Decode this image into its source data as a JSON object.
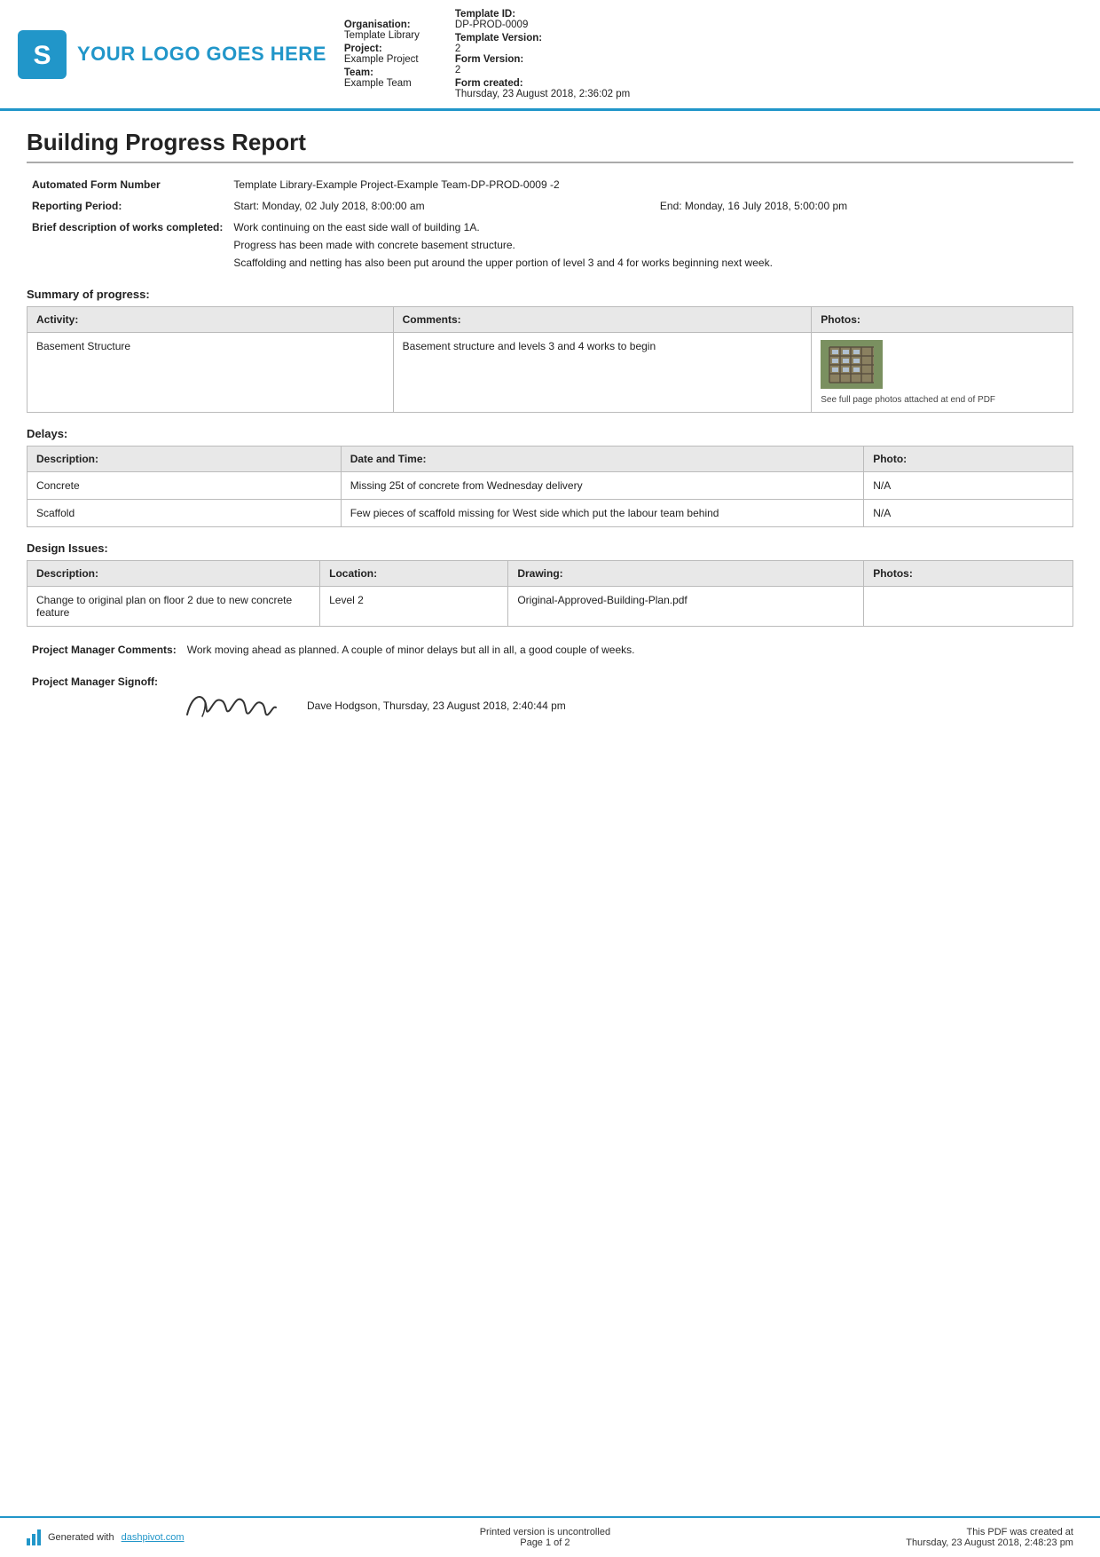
{
  "header": {
    "logo_text": "YOUR LOGO GOES HERE",
    "org_label": "Organisation:",
    "org_value": "Template Library",
    "project_label": "Project:",
    "project_value": "Example Project",
    "team_label": "Team:",
    "team_value": "Example Team",
    "template_id_label": "Template ID:",
    "template_id_value": "DP-PROD-0009",
    "template_version_label": "Template Version:",
    "template_version_value": "2",
    "form_version_label": "Form Version:",
    "form_version_value": "2",
    "form_created_label": "Form created:",
    "form_created_value": "Thursday, 23 August 2018, 2:36:02 pm"
  },
  "report": {
    "title": "Building Progress Report",
    "automated_form_number_label": "Automated Form Number",
    "automated_form_number_value": "Template Library-Example Project-Example Team-DP-PROD-0009   -2",
    "reporting_period_label": "Reporting Period:",
    "reporting_period_start": "Start: Monday, 02 July 2018, 8:00:00 am",
    "reporting_period_end": "End: Monday, 16 July 2018, 5:00:00 pm",
    "brief_description_label": "Brief description of works completed:",
    "brief_description_lines": [
      "Work continuing on the east side wall of building 1A.",
      "Progress has been made with concrete basement structure.",
      "Scaffolding and netting has also been put around the upper portion of level 3 and 4 for works beginning next week."
    ],
    "summary_header": "Summary of progress:",
    "summary_columns": [
      "Activity:",
      "Comments:",
      "Photos:"
    ],
    "summary_rows": [
      {
        "activity": "Basement Structure",
        "comments": "Basement structure and levels 3 and 4 works to begin",
        "has_photo": true,
        "photo_caption": "See full page photos attached at end of PDF"
      }
    ],
    "delays_header": "Delays:",
    "delays_columns": [
      "Description:",
      "Date and Time:",
      "Photo:"
    ],
    "delays_rows": [
      {
        "description": "Concrete",
        "date_time": "Missing 25t of concrete from Wednesday delivery",
        "photo": "N/A"
      },
      {
        "description": "Scaffold",
        "date_time": "Few pieces of scaffold missing for West side which put the labour team behind",
        "photo": "N/A"
      }
    ],
    "design_issues_header": "Design Issues:",
    "design_columns": [
      "Description:",
      "Location:",
      "Drawing:",
      "Photos:"
    ],
    "design_rows": [
      {
        "description": "Change to original plan on floor 2 due to new concrete feature",
        "location": "Level 2",
        "drawing": "Original-Approved-Building-Plan.pdf",
        "photo": ""
      }
    ],
    "pm_comments_label": "Project Manager Comments:",
    "pm_comments_value": "Work moving ahead as planned. A couple of minor delays but all in all, a good couple of weeks.",
    "pm_signoff_label": "Project Manager Signoff:",
    "pm_signoff_name": "Dave Hodgson, Thursday, 23 August 2018, 2:40:44 pm"
  },
  "footer": {
    "generated_text": "Generated with",
    "dashpivot_link_text": "dashpivot.com",
    "page_text": "Printed version is uncontrolled",
    "page_number": "Page 1 of 2",
    "pdf_created_label": "This PDF was created at",
    "pdf_created_value": "Thursday, 23 August 2018, 2:48:23 pm"
  }
}
